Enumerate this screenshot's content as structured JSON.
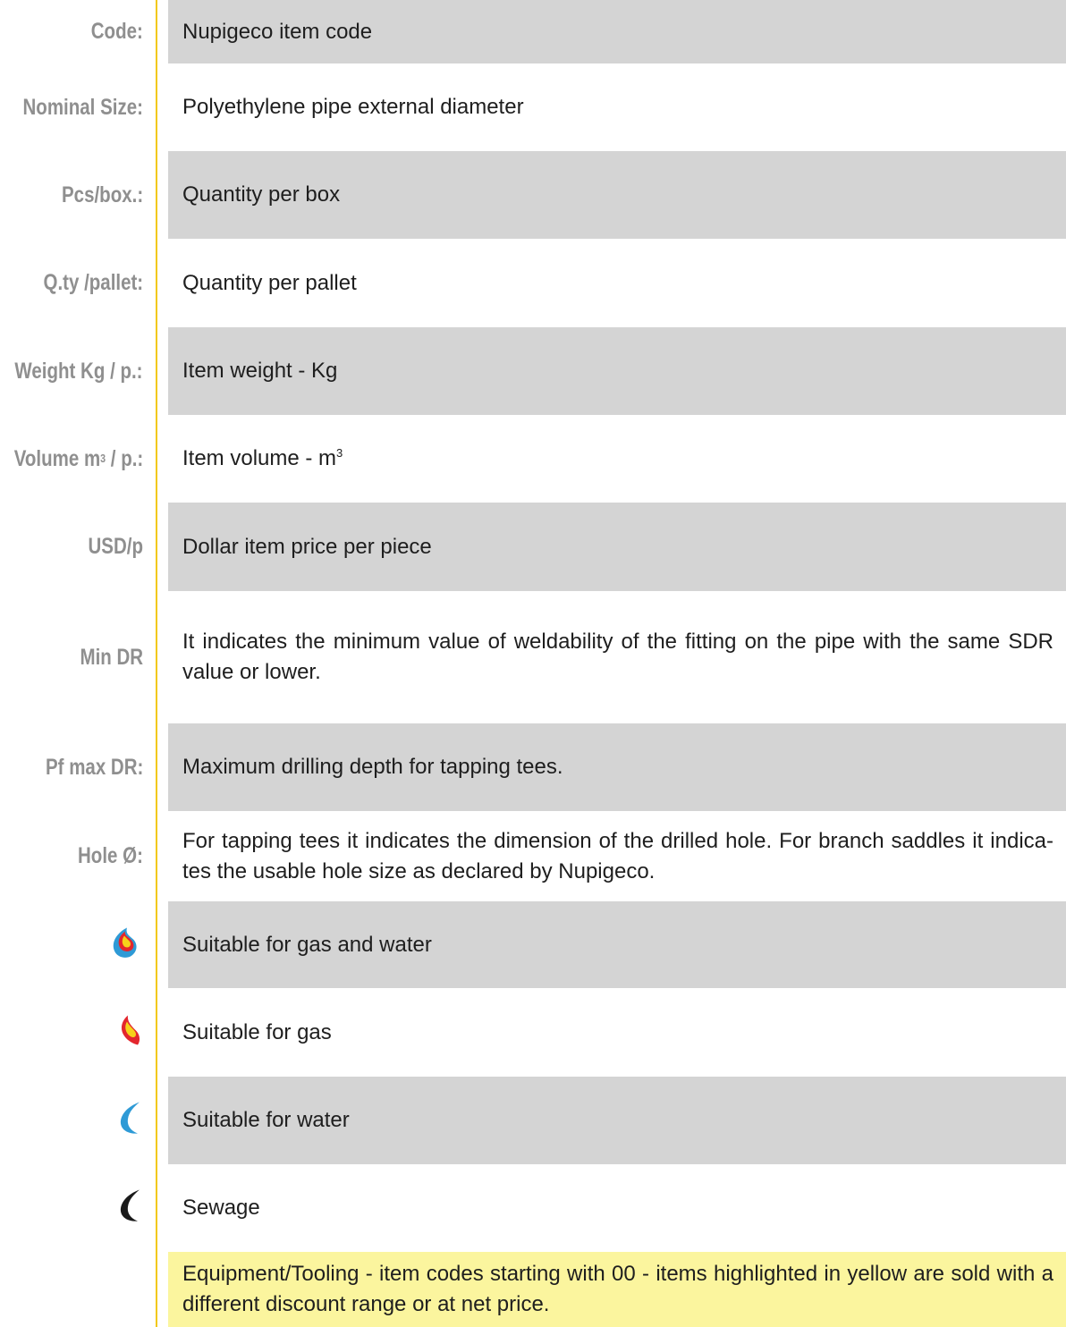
{
  "legend": {
    "rows": [
      {
        "label": "Code:",
        "description": "Nupigeco item code"
      },
      {
        "label": "Nominal Size:",
        "description": "Polyethylene pipe external diameter"
      },
      {
        "label": "Pcs/box.:",
        "description": "Quantity per box"
      },
      {
        "label": "Q.ty /pallet:",
        "description": "Quantity per pallet"
      },
      {
        "label": "Weight Kg / p.:",
        "description": "Item weight - Kg"
      },
      {
        "label_pre": "Volume m",
        "label_sup": "3",
        "label_post": "/ p.:",
        "description_pre": "Item volume - m",
        "description_sup": "3"
      },
      {
        "label": "USD/p",
        "description": "Dollar item price per piece"
      },
      {
        "label": "Min DR",
        "description": "It indicates the minimum value of weldability of the fitting on the pipe with the same SDR value or lower."
      },
      {
        "label": "Pf max DR:",
        "description": "Maximum drilling depth for tapping tees."
      },
      {
        "label": "Hole Ø:",
        "description": "For tapping tees it indicates the dimension of the drilled hole. For branch saddles it indica-tes the usable hole size as declared by Nupigeco."
      }
    ],
    "icon_rows": [
      {
        "icon": "gas-and-water-icon",
        "description": "Suitable for gas and water"
      },
      {
        "icon": "gas-flame-icon",
        "description": "Suitable for gas"
      },
      {
        "icon": "water-drop-icon",
        "description": "Suitable for water"
      },
      {
        "icon": "sewage-drop-icon",
        "description": "Sewage"
      }
    ],
    "note": "Equipment/Tooling - item codes starting with 00 - items highlighted in yellow are sold with a different discount range or at net price."
  },
  "colors": {
    "gray_band": "#d4d4d4",
    "highlight_yellow": "#fbf59e",
    "divider_yellow": "#f2c811",
    "label_gray": "#8f8f8f",
    "gas_red": "#e3262d",
    "gas_yellow": "#f6d21a",
    "water_blue": "#2e9ad6",
    "sewage_black": "#1a1a1a"
  }
}
